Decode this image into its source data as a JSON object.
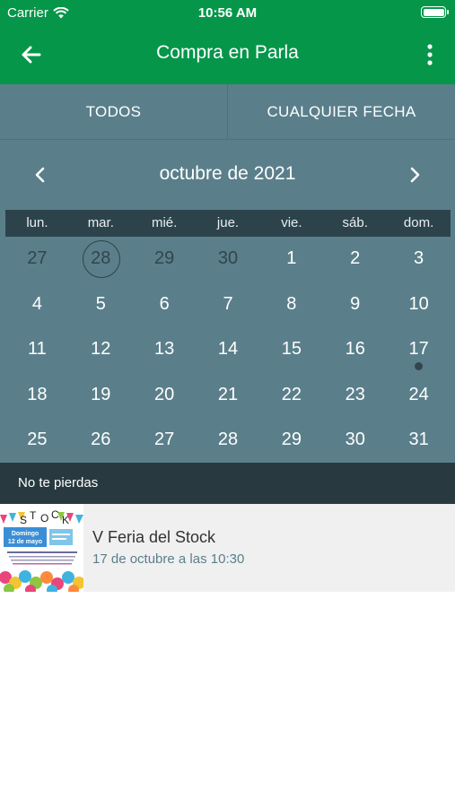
{
  "status_bar": {
    "carrier": "Carrier",
    "time": "10:56 AM"
  },
  "nav": {
    "title": "Compra en Parla",
    "back_icon": "arrow-left-icon",
    "more_icon": "more-vertical-icon"
  },
  "filters": {
    "category": "TODOS",
    "date": "CUALQUIER FECHA"
  },
  "calendar": {
    "month_label": "octubre de 2021",
    "weekdays": [
      "lun.",
      "mar.",
      "mié.",
      "jue.",
      "vie.",
      "sáb.",
      "dom."
    ],
    "weeks": [
      [
        "27",
        "28",
        "29",
        "30",
        "1",
        "2",
        "3"
      ],
      [
        "4",
        "5",
        "6",
        "7",
        "8",
        "9",
        "10"
      ],
      [
        "11",
        "12",
        "13",
        "14",
        "15",
        "16",
        "17"
      ],
      [
        "18",
        "19",
        "20",
        "21",
        "22",
        "23",
        "24"
      ],
      [
        "25",
        "26",
        "27",
        "28",
        "29",
        "30",
        "31"
      ]
    ],
    "today": "28 (previous month)",
    "event_days": [
      "17"
    ]
  },
  "section": {
    "title": "No te pierdas"
  },
  "events": [
    {
      "title": "V Feria del Stock",
      "date": "17 de octubre a las 10:30",
      "thumb": {
        "word": "STOCK",
        "line1": "Domingo",
        "line2": "12 de mayo"
      }
    }
  ],
  "colors": {
    "header_green": "#05964a",
    "calendar_bg": "#5a7f8b",
    "weekday_bar": "#2d434c",
    "section_bar": "#283a40",
    "event_bg": "#f0f0f0"
  }
}
